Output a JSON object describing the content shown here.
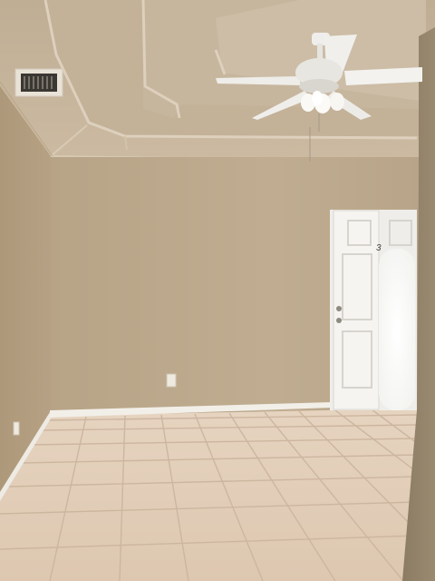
{
  "scene": {
    "door_number": "3"
  },
  "colors": {
    "back_wall": "#bca98d",
    "left_wall": "#b29d7f",
    "right_wall": "#8f8068",
    "ceiling": "#c9b8a0",
    "floor_tile": "#e3cfb9",
    "grout": "#cbb49d",
    "baseboard": "#f2efe9",
    "door": "#f4f3f0"
  }
}
